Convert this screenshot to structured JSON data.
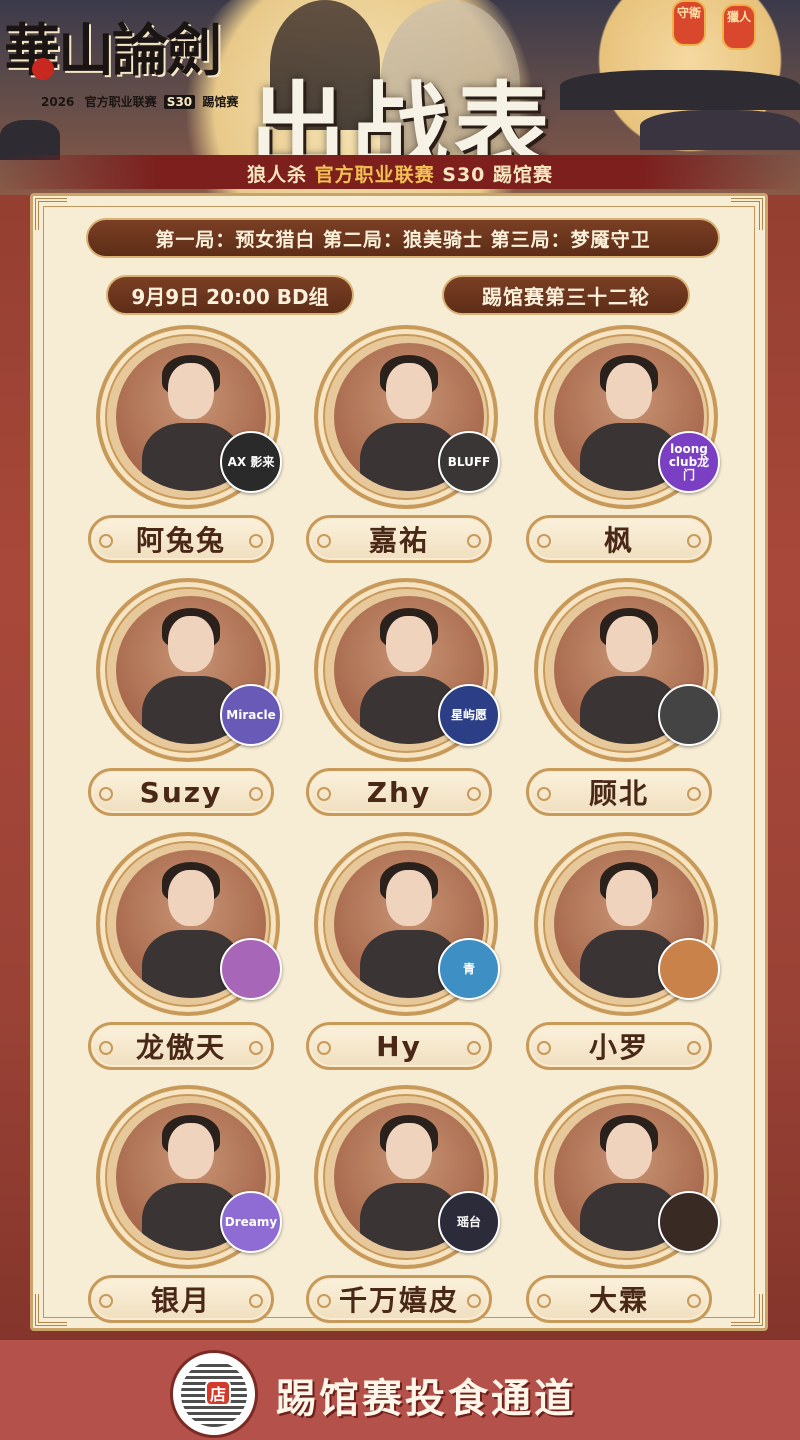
{
  "header": {
    "logo_title": "華山論劍",
    "logo_year": "2026",
    "logo_league": "官方职业联赛",
    "logo_season": "S30",
    "logo_stage": "踢馆赛",
    "main_title": "出战表",
    "banner_prefix": "狼人杀",
    "banner_highlight": "官方职业联赛",
    "banner_suffix": "S30 踢馆赛",
    "lanterns": [
      "守衛",
      "獵人"
    ]
  },
  "match": {
    "rounds": "第一局：预女猎白 第二局：狼美骑士 第三局：梦魇守卫",
    "date": "9月9日 20:00  BD组",
    "stage": "踢馆赛第三十二轮"
  },
  "players": [
    {
      "name": "阿兔兔",
      "team": "AX 影来",
      "team_color": "#2a2a2a"
    },
    {
      "name": "嘉祐",
      "team": "BLUFF",
      "team_color": "#3a3636"
    },
    {
      "name": "枫",
      "team": "loong club龙门",
      "team_color": "#7a3fc2"
    },
    {
      "name": "Suzy",
      "team": "Miracle",
      "team_color": "#6a5ab8"
    },
    {
      "name": "Zhy",
      "team": "星屿愿",
      "team_color": "#2c3f86"
    },
    {
      "name": "顾北",
      "team": "",
      "team_color": "#444444"
    },
    {
      "name": "龙傲天",
      "team": "",
      "team_color": "#a766b8"
    },
    {
      "name": "Hy",
      "team": "青",
      "team_color": "#3e8fc4"
    },
    {
      "name": "小罗",
      "team": "",
      "team_color": "#c9824a"
    },
    {
      "name": "银月",
      "team": "Dreamy",
      "team_color": "#8f6cd4"
    },
    {
      "name": "千万嬉皮",
      "team": "瑶台",
      "team_color": "#2b2b3a"
    },
    {
      "name": "大霖",
      "team": "",
      "team_color": "#3a2a24"
    }
  ],
  "footer": {
    "text": "踢馆赛投食通道",
    "qr_badge": "店"
  },
  "colors": {
    "accent": "#5e2d18",
    "gold": "#c89a5a",
    "card_bg": "#f7ecd4",
    "footer_bg": "#b4514a"
  }
}
